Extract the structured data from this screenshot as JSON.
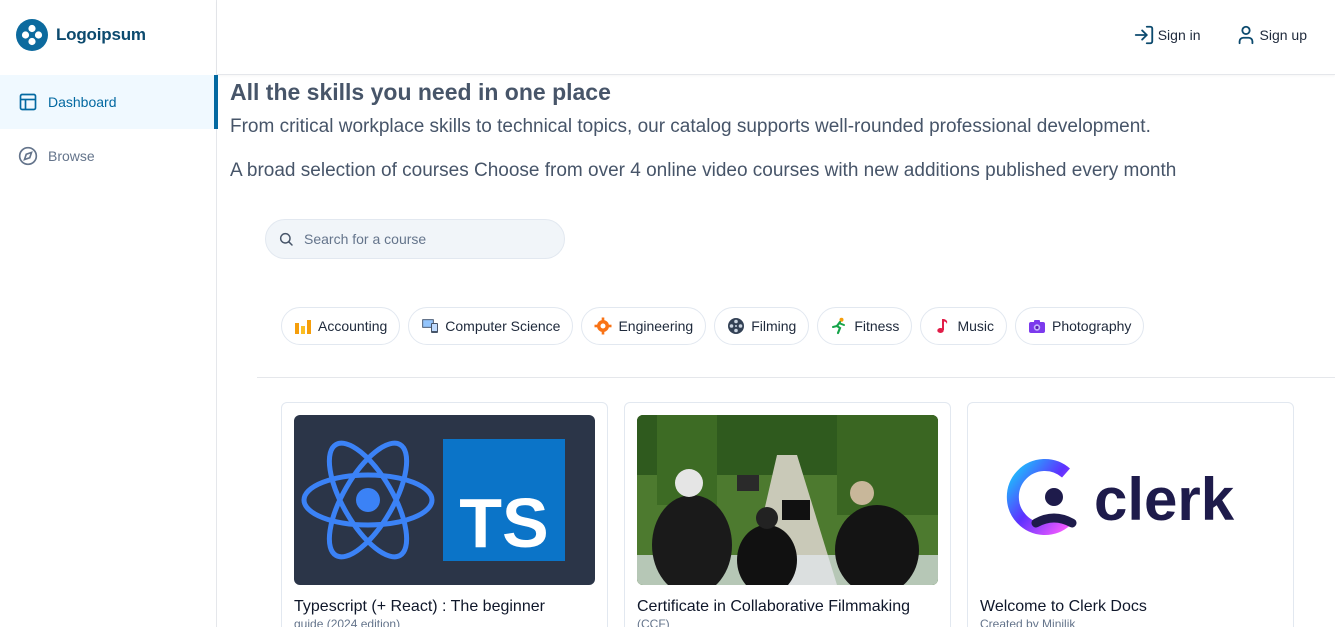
{
  "brand": {
    "name": "Logoipsum",
    "color": "#0c6a9e"
  },
  "sidebar": {
    "items": [
      {
        "label": "Dashboard",
        "icon": "layout-icon",
        "active": true
      },
      {
        "label": "Browse",
        "icon": "compass-icon",
        "active": false
      }
    ]
  },
  "header": {
    "sign_in": "Sign in",
    "sign_up": "Sign up"
  },
  "hero": {
    "title": "All the skills you need in one place",
    "subtitle": "From critical workplace skills to technical topics, our catalog supports well-rounded professional development.",
    "subtitle2": "A broad selection of courses Choose from over 4 online video courses with new additions published every month"
  },
  "search": {
    "placeholder": "Search for a course"
  },
  "categories": [
    {
      "label": "Accounting",
      "icon": "bar-chart-icon"
    },
    {
      "label": "Computer Science",
      "icon": "computer-icon"
    },
    {
      "label": "Engineering",
      "icon": "gear-icon"
    },
    {
      "label": "Filming",
      "icon": "film-reel-icon"
    },
    {
      "label": "Fitness",
      "icon": "runner-icon"
    },
    {
      "label": "Music",
      "icon": "music-note-icon"
    },
    {
      "label": "Photography",
      "icon": "camera-icon"
    }
  ],
  "courses": [
    {
      "title": "Typescript (+ React) : The beginner",
      "meta": "guide (2024 edition)",
      "image": "react-typescript-thumbnail"
    },
    {
      "title": "Certificate in Collaborative Filmmaking",
      "meta": "(CCF)",
      "image": "filmmaking-photo"
    },
    {
      "title": "Welcome to Clerk Docs",
      "meta": "Created by Minilik",
      "image": "clerk-logo",
      "logo_text": "clerk"
    }
  ],
  "colors": {
    "accent": "#0369a1",
    "active_bg": "#f0f9ff"
  }
}
